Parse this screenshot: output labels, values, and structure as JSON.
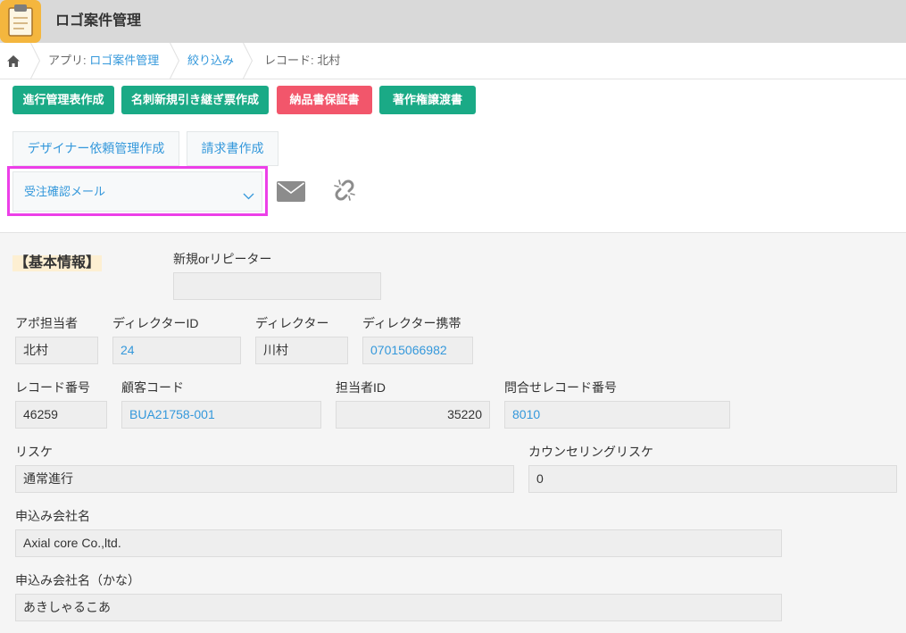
{
  "theme": {
    "header_bg": "#d9d9d9",
    "link": "#3498db",
    "app_icon_bg": "#f4b63e",
    "highlight": "#ec3fe8"
  },
  "header": {
    "app_icon": "clipboard-icon",
    "title": "ロゴ案件管理"
  },
  "breadcrumb": {
    "home_icon": "home-icon",
    "app_prefix": "アプリ: ",
    "app_name": "ロゴ案件管理",
    "filter": "絞り込み",
    "record": "レコード: 北村"
  },
  "toolbar": {
    "primary_buttons": [
      {
        "label": "進行管理表作成",
        "color": "#1aaa86"
      },
      {
        "label": "名刺新規引き継ぎ票作成",
        "color": "#1aaa86"
      },
      {
        "label": "納品書保証書",
        "color": "#f2566b"
      },
      {
        "label": "著作権譲渡書",
        "color": "#1aaa86"
      }
    ],
    "secondary_buttons": [
      {
        "label": "デザイナー依頼管理作成"
      },
      {
        "label": "請求書作成"
      }
    ],
    "mail_select": {
      "selected": "受注確認メール",
      "icon": "chevron-down-icon"
    },
    "mail_icon": "mail-icon",
    "unlink_icon": "broken-link-icon"
  },
  "record": {
    "section_title": "【基本情報】",
    "rows": [
      {
        "fields": [
          {
            "label": "新規orリピーター",
            "value": ""
          }
        ]
      },
      {
        "fields": [
          {
            "label": "アポ担当者",
            "value": "北村"
          },
          {
            "label": "ディレクターID",
            "value": "24"
          },
          {
            "label": "ディレクター",
            "value": "川村"
          },
          {
            "label": "ディレクター携帯",
            "value": "07015066982"
          }
        ]
      },
      {
        "fields": [
          {
            "label": "レコード番号",
            "value": "46259"
          },
          {
            "label": "顧客コード",
            "value": "BUA21758-001"
          },
          {
            "label": "担当者ID",
            "value": "35220"
          },
          {
            "label": "問合せレコード番号",
            "value": "8010"
          }
        ]
      },
      {
        "fields": [
          {
            "label": "リスケ",
            "value": "通常進行"
          },
          {
            "label": "カウンセリングリスケ",
            "value": "0"
          }
        ]
      },
      {
        "fields": [
          {
            "label": "申込み会社名",
            "value": "Axial core Co.,ltd."
          }
        ]
      },
      {
        "fields": [
          {
            "label": "申込み会社名（かな）",
            "value": "あきしゃるこあ"
          }
        ]
      }
    ]
  }
}
